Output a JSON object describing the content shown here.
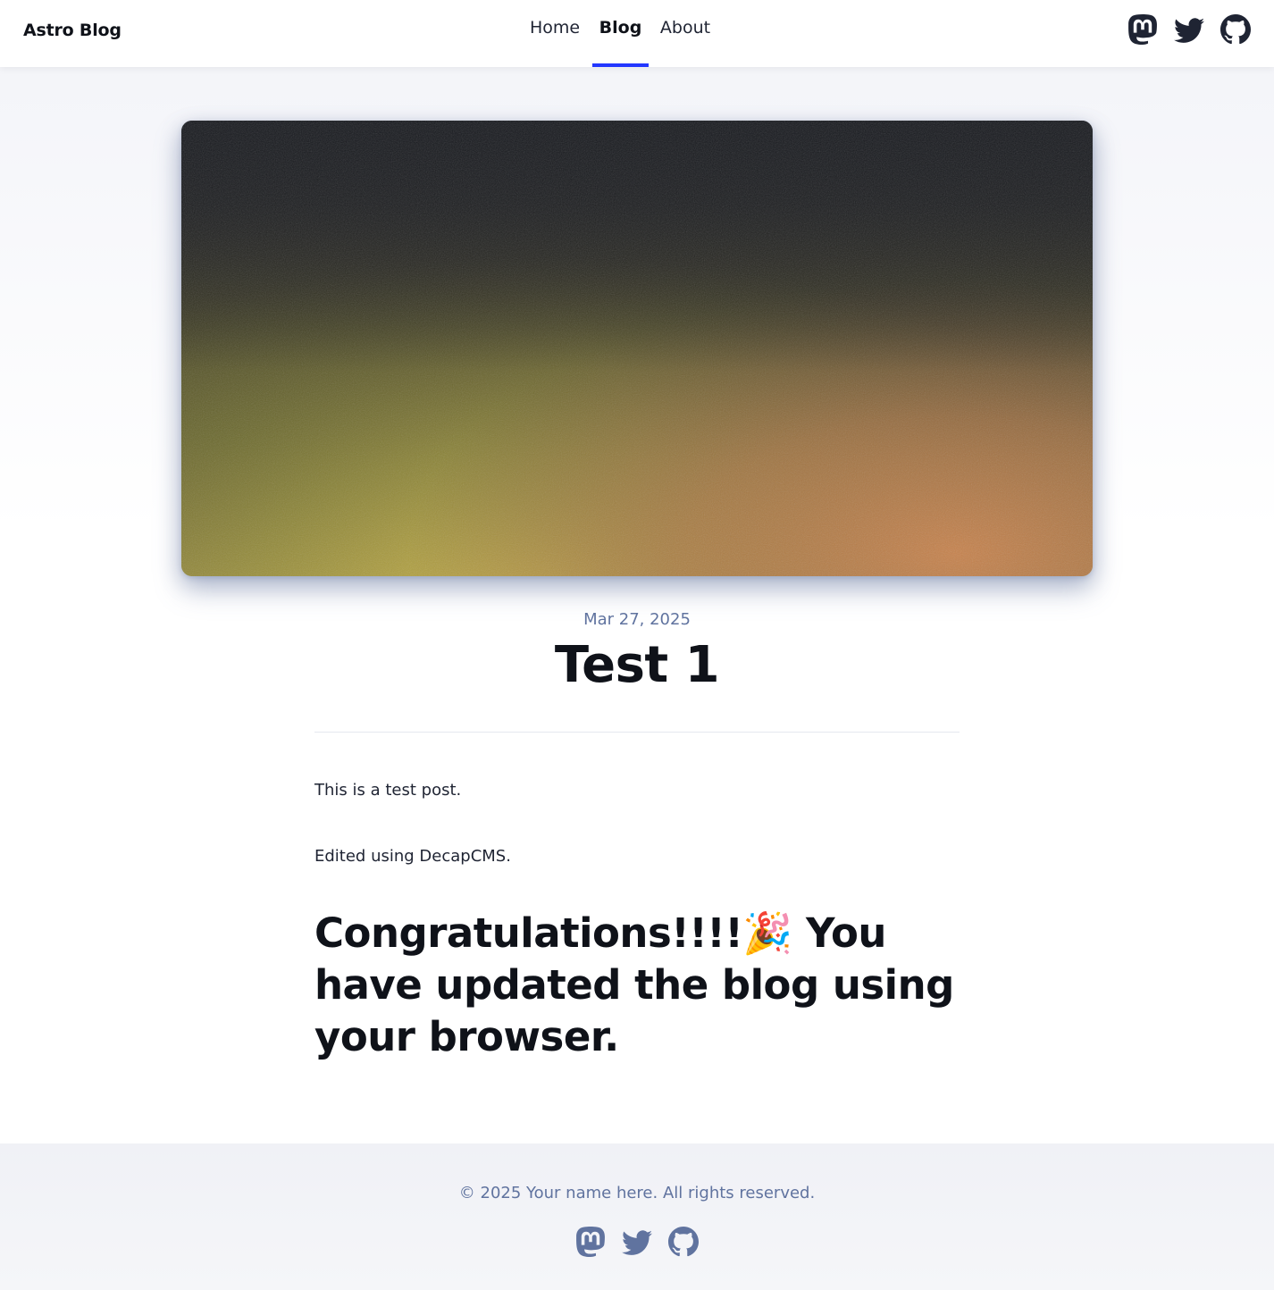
{
  "header": {
    "brand": "Astro Blog",
    "nav": [
      {
        "label": "Home",
        "active": false
      },
      {
        "label": "Blog",
        "active": true
      },
      {
        "label": "About",
        "active": false
      }
    ],
    "social_icons": [
      "mastodon-icon",
      "twitter-icon",
      "github-icon"
    ],
    "accent_color": "#2337ff"
  },
  "post": {
    "date": "Mar 27, 2025",
    "title": "Test 1",
    "paragraphs": [
      "This is a test post.",
      "Edited using DecapCMS."
    ],
    "heading": "Congratulations!!!!🎉 You have updated the blog using your browser."
  },
  "footer": {
    "copyright": "© 2025 Your name here. All rights reserved.",
    "social_icons": [
      "mastodon-icon",
      "twitter-icon",
      "github-icon"
    ]
  },
  "colors": {
    "text": "#0f1219",
    "muted": "#60739f",
    "background": "#f2f3f8"
  }
}
